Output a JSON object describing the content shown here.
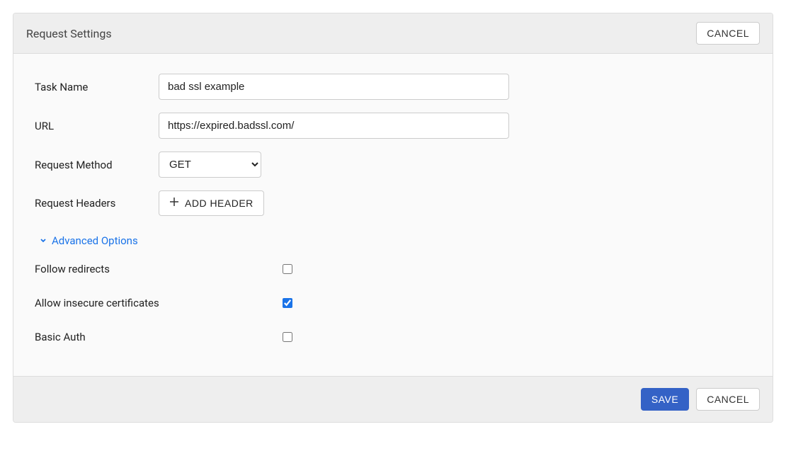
{
  "header": {
    "title": "Request Settings",
    "cancel": "CANCEL"
  },
  "form": {
    "taskName": {
      "label": "Task Name",
      "value": "bad ssl example"
    },
    "url": {
      "label": "URL",
      "value": "https://expired.badssl.com/"
    },
    "requestMethod": {
      "label": "Request Method",
      "value": "GET"
    },
    "requestHeaders": {
      "label": "Request Headers",
      "addButton": "ADD HEADER"
    },
    "advancedToggle": "Advanced Options",
    "followRedirects": {
      "label": "Follow redirects",
      "checked": false
    },
    "allowInsecure": {
      "label": "Allow insecure certificates",
      "checked": true
    },
    "basicAuth": {
      "label": "Basic Auth",
      "checked": false
    }
  },
  "footer": {
    "save": "SAVE",
    "cancel": "CANCEL"
  }
}
